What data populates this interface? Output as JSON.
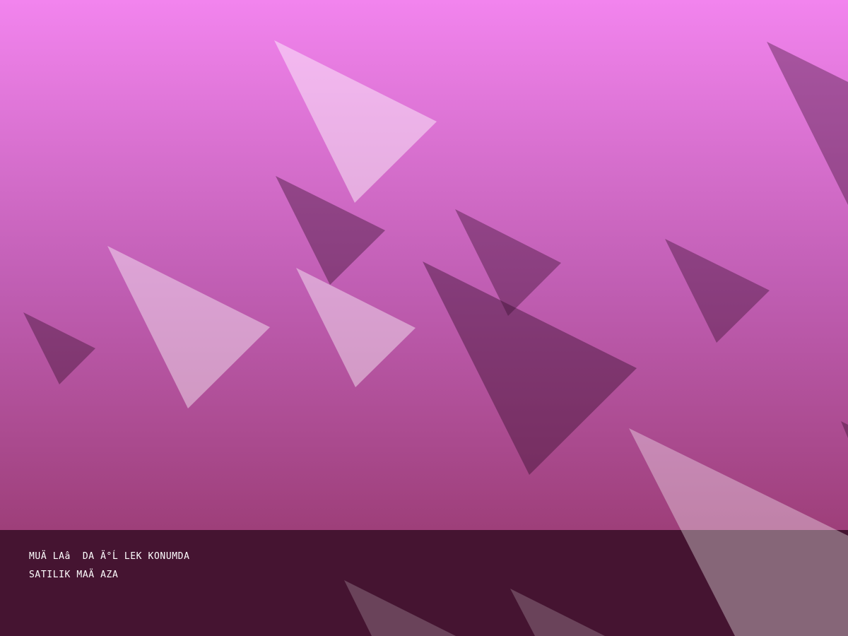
{
  "colors": {
    "gradient_top": "#f284ee",
    "gradient_bottom": "#9e3f7a",
    "light_triangle": "#ffffff",
    "dark_triangle": "#3a1030",
    "caption_panel": "#3d1730",
    "caption_text": "#ffffff"
  },
  "caption": {
    "line1": "MUÄ LAâ  DA Ä°Ĺ LEK KONUMDA",
    "line2": "SATILIK MAÄ AZA"
  }
}
